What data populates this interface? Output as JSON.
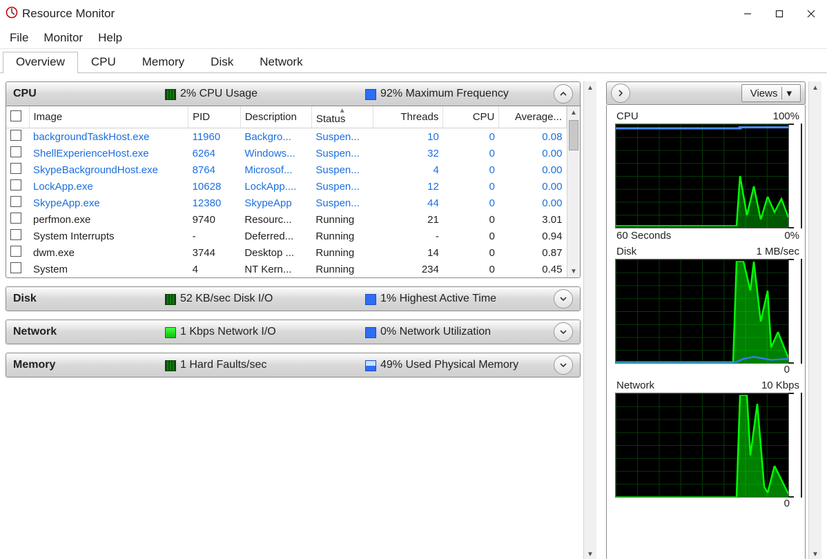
{
  "window": {
    "title": "Resource Monitor"
  },
  "menu": {
    "file": "File",
    "monitor": "Monitor",
    "help": "Help"
  },
  "tabs": {
    "overview": "Overview",
    "cpu": "CPU",
    "memory": "Memory",
    "disk": "Disk",
    "network": "Network"
  },
  "panels": {
    "cpu": {
      "title": "CPU",
      "usage": "2% CPU Usage",
      "freq": "92% Maximum Frequency",
      "columns": {
        "image": "Image",
        "pid": "PID",
        "desc": "Description",
        "status": "Status",
        "threads": "Threads",
        "cpu": "CPU",
        "avg": "Average..."
      },
      "rows": [
        {
          "image": "backgroundTaskHost.exe",
          "pid": "11960",
          "desc": "Backgro...",
          "status": "Suspen...",
          "threads": "10",
          "cpu": "0",
          "avg": "0.08",
          "susp": true
        },
        {
          "image": "ShellExperienceHost.exe",
          "pid": "6264",
          "desc": "Windows...",
          "status": "Suspen...",
          "threads": "32",
          "cpu": "0",
          "avg": "0.00",
          "susp": true
        },
        {
          "image": "SkypeBackgroundHost.exe",
          "pid": "8764",
          "desc": "Microsof...",
          "status": "Suspen...",
          "threads": "4",
          "cpu": "0",
          "avg": "0.00",
          "susp": true
        },
        {
          "image": "LockApp.exe",
          "pid": "10628",
          "desc": "LockApp....",
          "status": "Suspen...",
          "threads": "12",
          "cpu": "0",
          "avg": "0.00",
          "susp": true
        },
        {
          "image": "SkypeApp.exe",
          "pid": "12380",
          "desc": "SkypeApp",
          "status": "Suspen...",
          "threads": "44",
          "cpu": "0",
          "avg": "0.00",
          "susp": true
        },
        {
          "image": "perfmon.exe",
          "pid": "9740",
          "desc": "Resourc...",
          "status": "Running",
          "threads": "21",
          "cpu": "0",
          "avg": "3.01",
          "susp": false
        },
        {
          "image": "System Interrupts",
          "pid": "-",
          "desc": "Deferred...",
          "status": "Running",
          "threads": "-",
          "cpu": "0",
          "avg": "0.94",
          "susp": false
        },
        {
          "image": "dwm.exe",
          "pid": "3744",
          "desc": "Desktop ...",
          "status": "Running",
          "threads": "14",
          "cpu": "0",
          "avg": "0.87",
          "susp": false
        },
        {
          "image": "System",
          "pid": "4",
          "desc": "NT Kern...",
          "status": "Running",
          "threads": "234",
          "cpu": "0",
          "avg": "0.45",
          "susp": false
        }
      ]
    },
    "disk": {
      "title": "Disk",
      "stat1": "52 KB/sec Disk I/O",
      "stat2": "1% Highest Active Time"
    },
    "network": {
      "title": "Network",
      "stat1": "1 Kbps Network I/O",
      "stat2": "0% Network Utilization"
    },
    "memory": {
      "title": "Memory",
      "stat1": "1 Hard Faults/sec",
      "stat2": "49% Used Physical Memory"
    }
  },
  "right": {
    "views": "Views",
    "charts": {
      "cpu": {
        "title": "CPU",
        "max": "100%",
        "caption_left": "60 Seconds",
        "caption_right": "0%"
      },
      "disk": {
        "title": "Disk",
        "max": "1 MB/sec",
        "bottom_right": "0"
      },
      "network": {
        "title": "Network",
        "max": "10 Kbps",
        "bottom_right": "0"
      }
    }
  }
}
